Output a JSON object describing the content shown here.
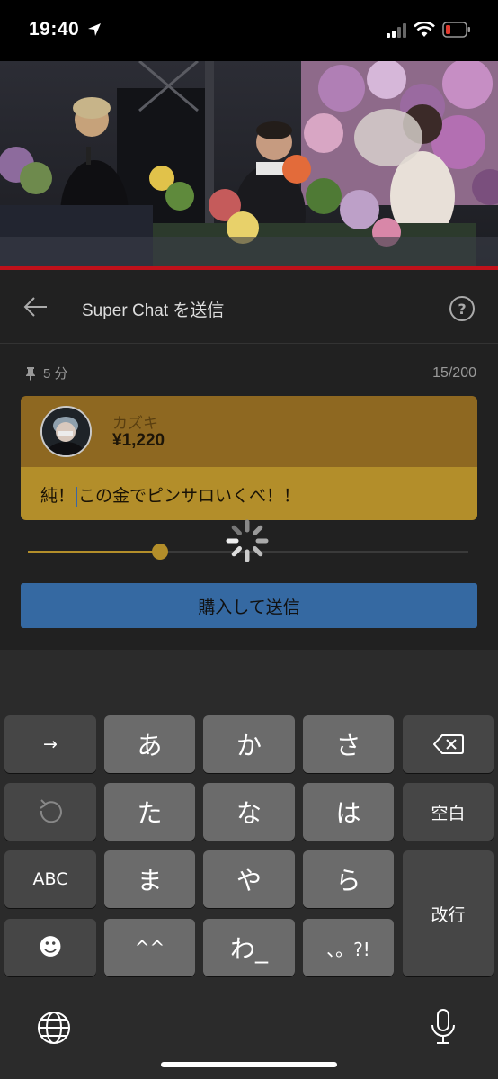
{
  "status_bar": {
    "time": "19:40"
  },
  "super_chat": {
    "title": "Super Chat を送信",
    "pin_duration": "5 分",
    "char_count": "15/200",
    "username": "カズキ",
    "amount": "¥1,220",
    "message_before_cursor": "純！",
    "message_after_cursor": "この金でピンサロいくべ！！",
    "slider_level": 0.3,
    "buy_label": "購入して送信"
  },
  "keyboard": {
    "rows": [
      [
        "→",
        "あ",
        "か",
        "さ",
        "⌫"
      ],
      [
        "↺",
        "た",
        "な",
        "は",
        "空白"
      ],
      [
        "ABC",
        "ま",
        "や",
        "ら",
        "改行"
      ],
      [
        "☻",
        "^^",
        "わ_",
        "、。?!"
      ]
    ],
    "key_next": "→",
    "key_a": "あ",
    "key_ka": "か",
    "key_sa": "さ",
    "key_undo": "↺",
    "key_ta": "た",
    "key_na": "な",
    "key_ha": "は",
    "key_space": "空白",
    "key_abc": "ABC",
    "key_ma": "ま",
    "key_ya": "や",
    "key_ra": "ら",
    "key_enter": "改行",
    "key_emoji": "☻",
    "key_kaomoji": "^^",
    "key_wa": "わ_",
    "key_punct": "、。?!"
  },
  "colors": {
    "card_top": "#8e6821",
    "card_bottom": "#b38e2a",
    "button_blue": "#3569a2",
    "video_progress": "#c0111a"
  }
}
